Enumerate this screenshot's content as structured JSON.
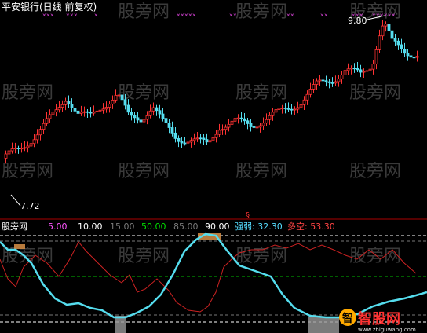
{
  "main_panel": {
    "title": "平安银行(日线 前复权)",
    "high_label": "9.80",
    "low_label": "7.72"
  },
  "indicator_panel": {
    "name": "股旁网",
    "items": [
      {
        "label": "5.00",
        "color": "#ff55ff"
      },
      {
        "label": "10.00",
        "color": "#ffffff"
      },
      {
        "label": "15.00",
        "color": "#7a7a7a"
      },
      {
        "label": "50.00",
        "color": "#00dd00"
      },
      {
        "label": "85.00",
        "color": "#7a7a7a"
      },
      {
        "label": "90.00",
        "color": "#ffffff"
      },
      {
        "label": "强弱: 32.30",
        "color": "#55ddff"
      },
      {
        "label": "多空: 53.30",
        "color": "#ff4444"
      }
    ]
  },
  "watermarks": [
    "股旁网"
  ],
  "logo": {
    "text": "智股网",
    "subtext": "www.zhiguwang.com"
  },
  "colors": {
    "up": "#ff3333",
    "down": "#55ddee",
    "strength_line": "#55ddee",
    "longshort_line": "#cc2222",
    "marker": "#dd44dd"
  },
  "chart_data": {
    "type": "candlestick",
    "price_range": [
      7.72,
      9.8
    ],
    "series": [
      {
        "name": "强弱",
        "last": 32.3
      },
      {
        "name": "多空",
        "last": 53.3
      }
    ],
    "indicator_levels": [
      5,
      10,
      15,
      50,
      85,
      90
    ]
  }
}
